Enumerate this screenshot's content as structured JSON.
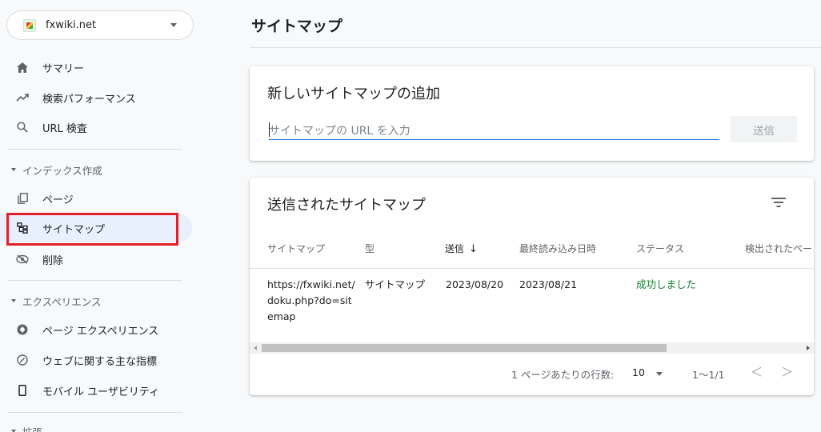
{
  "sidebar": {
    "property": {
      "name": "fxwiki.net"
    },
    "items": [
      {
        "label": "サマリー",
        "icon": "home-icon"
      },
      {
        "label": "検索パフォーマンス",
        "icon": "trending-up-icon"
      },
      {
        "label": "URL 検査",
        "icon": "search-icon"
      }
    ],
    "sections": [
      {
        "title": "インデックス作成",
        "items": [
          {
            "label": "ページ",
            "icon": "pages-icon"
          },
          {
            "label": "サイトマップ",
            "icon": "sitemap-icon",
            "active": true
          },
          {
            "label": "削除",
            "icon": "removal-icon"
          }
        ]
      },
      {
        "title": "エクスペリエンス",
        "items": [
          {
            "label": "ページ エクスペリエンス",
            "icon": "page-experience-icon"
          },
          {
            "label": "ウェブに関する主な指標",
            "icon": "core-web-vitals-icon"
          },
          {
            "label": "モバイル ユーザビリティ",
            "icon": "mobile-icon"
          }
        ]
      },
      {
        "title": "拡張"
      }
    ]
  },
  "main": {
    "title": "サイトマップ",
    "add_card": {
      "heading": "新しいサイトマップの追加",
      "input_placeholder": "サイトマップの URL を入力",
      "submit_label": "送信"
    },
    "list_card": {
      "heading": "送信されたサイトマップ",
      "columns": [
        "サイトマップ",
        "型",
        "送信",
        "最終読み込み日時",
        "ステータス",
        "検出されたペー"
      ],
      "sort_arrow": "↓",
      "rows": [
        {
          "sitemap": "https://fxwiki.net/doku.php?do=sitemap",
          "type": "サイトマップ",
          "submitted": "2023/08/20",
          "last_read": "2023/08/21",
          "status": "成功しました"
        }
      ],
      "pagination": {
        "rows_per_page_label": "1 ページあたりの行数:",
        "rows_per_page": "10",
        "range": "1～1/1",
        "prev": "＜",
        "next": "＞"
      }
    }
  },
  "colors": {
    "accent": "#1a73e8",
    "success": "#188038",
    "active_bg": "#e8f0fe",
    "highlight": "#e0202a"
  }
}
